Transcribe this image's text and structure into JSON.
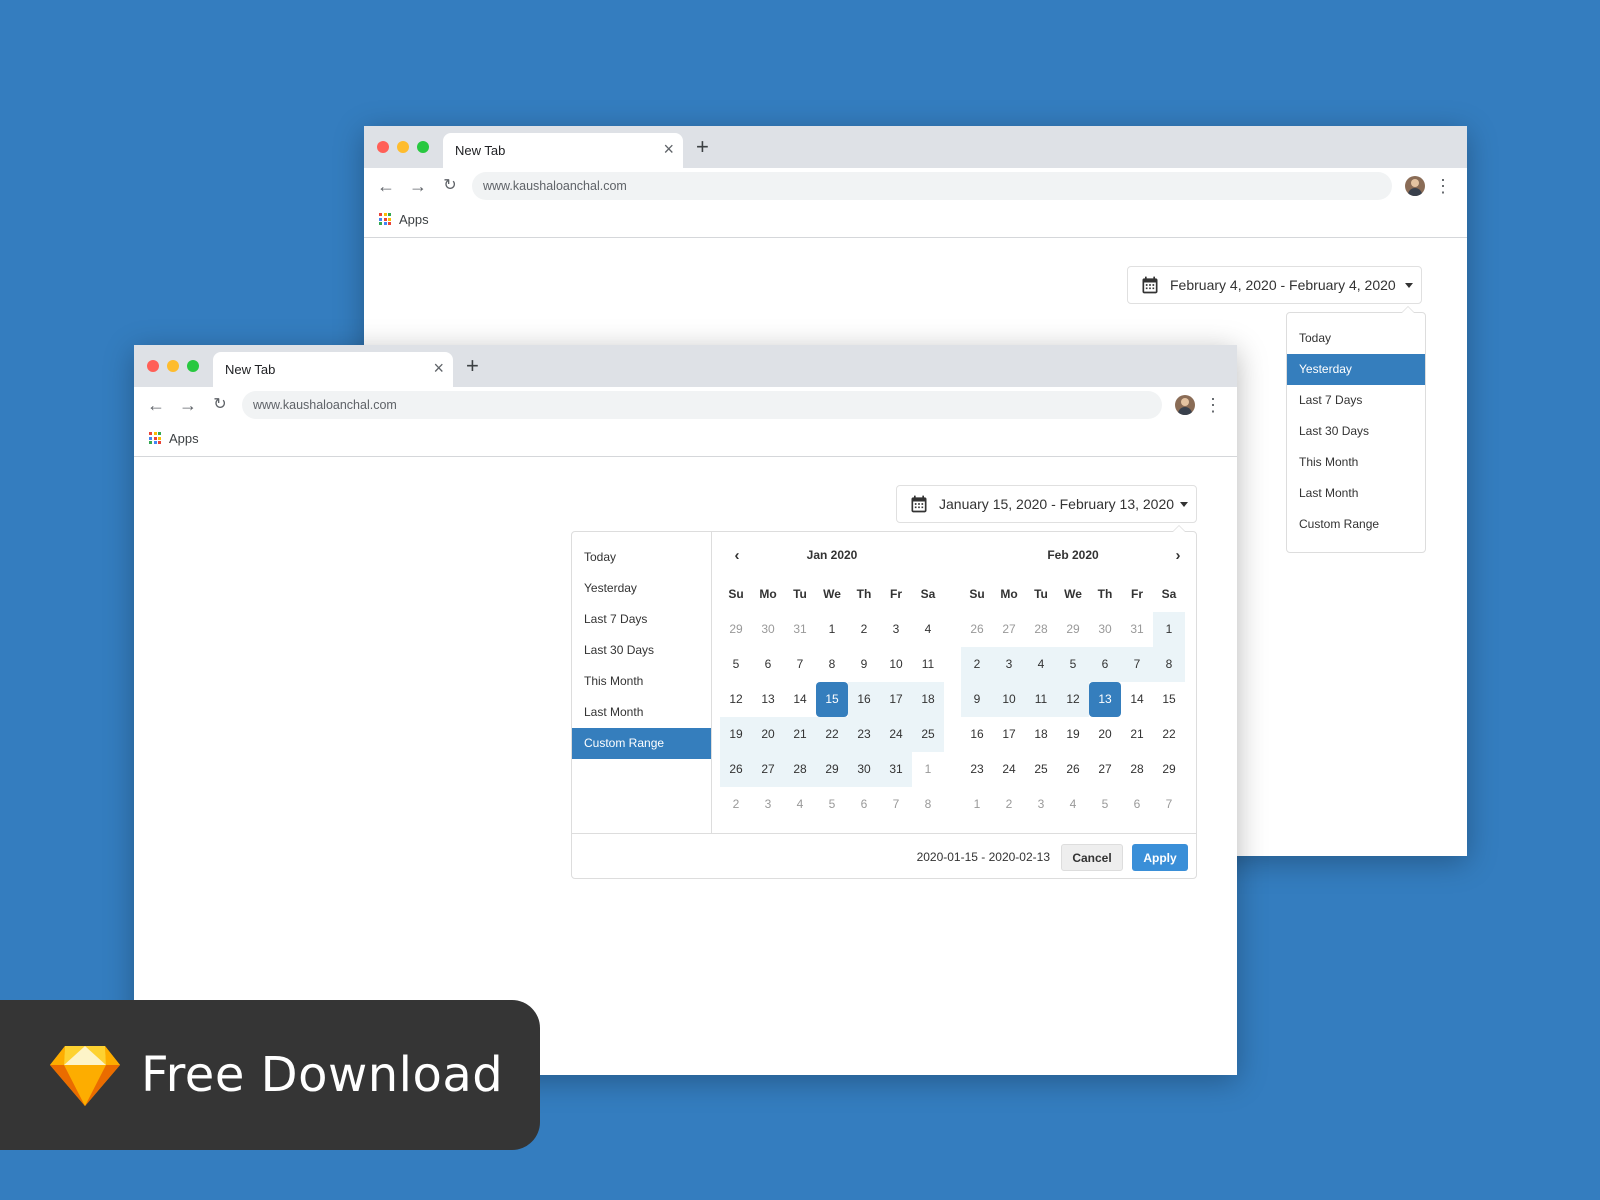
{
  "colors": {
    "background": "#347dbf",
    "accent": "#357ebd",
    "apply_button": "#3a8fd8",
    "in_range": "#ebf4f8",
    "banner": "#353535",
    "apps_grid": [
      "#ea4335",
      "#fbbc05",
      "#34a853",
      "#4285f4",
      "#ea4335",
      "#fbbc05",
      "#34a853",
      "#4285f4",
      "#ea4335"
    ]
  },
  "back_window": {
    "tab_title": "New Tab",
    "url": "www.kaushaloanchal.com",
    "bookmark_apps": "Apps",
    "daterange_text": "February 4, 2020 - February 4, 2020",
    "ranges": [
      {
        "label": "Today",
        "active": false
      },
      {
        "label": "Yesterday",
        "active": true
      },
      {
        "label": "Last 7 Days",
        "active": false
      },
      {
        "label": "Last 30 Days",
        "active": false
      },
      {
        "label": "This Month",
        "active": false
      },
      {
        "label": "Last Month",
        "active": false
      },
      {
        "label": "Custom Range",
        "active": false
      }
    ]
  },
  "front_window": {
    "tab_title": "New Tab",
    "url": "www.kaushaloanchal.com",
    "bookmark_apps": "Apps",
    "daterange_text": "January 15, 2020 - February 13, 2020",
    "ranges": [
      {
        "label": "Today",
        "active": false
      },
      {
        "label": "Yesterday",
        "active": false
      },
      {
        "label": "Last 7 Days",
        "active": false
      },
      {
        "label": "Last 30 Days",
        "active": false
      },
      {
        "label": "This Month",
        "active": false
      },
      {
        "label": "Last Month",
        "active": false
      },
      {
        "label": "Custom Range",
        "active": true
      }
    ],
    "weekdays": [
      "Su",
      "Mo",
      "Tu",
      "We",
      "Th",
      "Fr",
      "Sa"
    ],
    "calendars": [
      {
        "month": "Jan 2020",
        "weeks": [
          [
            {
              "d": "29",
              "off": true
            },
            {
              "d": "30",
              "off": true
            },
            {
              "d": "31",
              "off": true
            },
            {
              "d": "1"
            },
            {
              "d": "2"
            },
            {
              "d": "3"
            },
            {
              "d": "4"
            }
          ],
          [
            {
              "d": "5"
            },
            {
              "d": "6"
            },
            {
              "d": "7"
            },
            {
              "d": "8"
            },
            {
              "d": "9"
            },
            {
              "d": "10"
            },
            {
              "d": "11"
            }
          ],
          [
            {
              "d": "12"
            },
            {
              "d": "13"
            },
            {
              "d": "14"
            },
            {
              "d": "15",
              "sel": true
            },
            {
              "d": "16",
              "in": true
            },
            {
              "d": "17",
              "in": true
            },
            {
              "d": "18",
              "in": true
            }
          ],
          [
            {
              "d": "19",
              "in": true
            },
            {
              "d": "20",
              "in": true
            },
            {
              "d": "21",
              "in": true
            },
            {
              "d": "22",
              "in": true
            },
            {
              "d": "23",
              "in": true
            },
            {
              "d": "24",
              "in": true
            },
            {
              "d": "25",
              "in": true
            }
          ],
          [
            {
              "d": "26",
              "in": true
            },
            {
              "d": "27",
              "in": true
            },
            {
              "d": "28",
              "in": true
            },
            {
              "d": "29",
              "in": true
            },
            {
              "d": "30",
              "in": true
            },
            {
              "d": "31",
              "in": true
            },
            {
              "d": "1",
              "off": true
            }
          ],
          [
            {
              "d": "2",
              "off": true
            },
            {
              "d": "3",
              "off": true
            },
            {
              "d": "4",
              "off": true
            },
            {
              "d": "5",
              "off": true
            },
            {
              "d": "6",
              "off": true
            },
            {
              "d": "7",
              "off": true
            },
            {
              "d": "8",
              "off": true
            }
          ]
        ]
      },
      {
        "month": "Feb 2020",
        "weeks": [
          [
            {
              "d": "26",
              "off": true
            },
            {
              "d": "27",
              "off": true
            },
            {
              "d": "28",
              "off": true
            },
            {
              "d": "29",
              "off": true
            },
            {
              "d": "30",
              "off": true
            },
            {
              "d": "31",
              "off": true
            },
            {
              "d": "1",
              "in": true
            }
          ],
          [
            {
              "d": "2",
              "in": true
            },
            {
              "d": "3",
              "in": true
            },
            {
              "d": "4",
              "in": true
            },
            {
              "d": "5",
              "in": true
            },
            {
              "d": "6",
              "in": true
            },
            {
              "d": "7",
              "in": true
            },
            {
              "d": "8",
              "in": true
            }
          ],
          [
            {
              "d": "9",
              "in": true
            },
            {
              "d": "10",
              "in": true
            },
            {
              "d": "11",
              "in": true
            },
            {
              "d": "12",
              "in": true
            },
            {
              "d": "13",
              "sel": true
            },
            {
              "d": "14"
            },
            {
              "d": "15"
            }
          ],
          [
            {
              "d": "16"
            },
            {
              "d": "17"
            },
            {
              "d": "18"
            },
            {
              "d": "19"
            },
            {
              "d": "20"
            },
            {
              "d": "21"
            },
            {
              "d": "22"
            }
          ],
          [
            {
              "d": "23"
            },
            {
              "d": "24"
            },
            {
              "d": "25"
            },
            {
              "d": "26"
            },
            {
              "d": "27"
            },
            {
              "d": "28"
            },
            {
              "d": "29"
            }
          ],
          [
            {
              "d": "1",
              "off": true
            },
            {
              "d": "2",
              "off": true
            },
            {
              "d": "3",
              "off": true
            },
            {
              "d": "4",
              "off": true
            },
            {
              "d": "5",
              "off": true
            },
            {
              "d": "6",
              "off": true
            },
            {
              "d": "7",
              "off": true
            }
          ]
        ]
      }
    ],
    "footer_range": "2020-01-15 - 2020-02-13",
    "cancel_label": "Cancel",
    "apply_label": "Apply"
  },
  "banner": {
    "text": "Free Download",
    "logo_icon": "sketch-logo-icon"
  },
  "icons": {
    "tab_close": "×",
    "new_tab": "+",
    "back": "←",
    "forward": "→",
    "reload": "↻",
    "menu": "⋮",
    "prev": "‹",
    "next": "›"
  }
}
